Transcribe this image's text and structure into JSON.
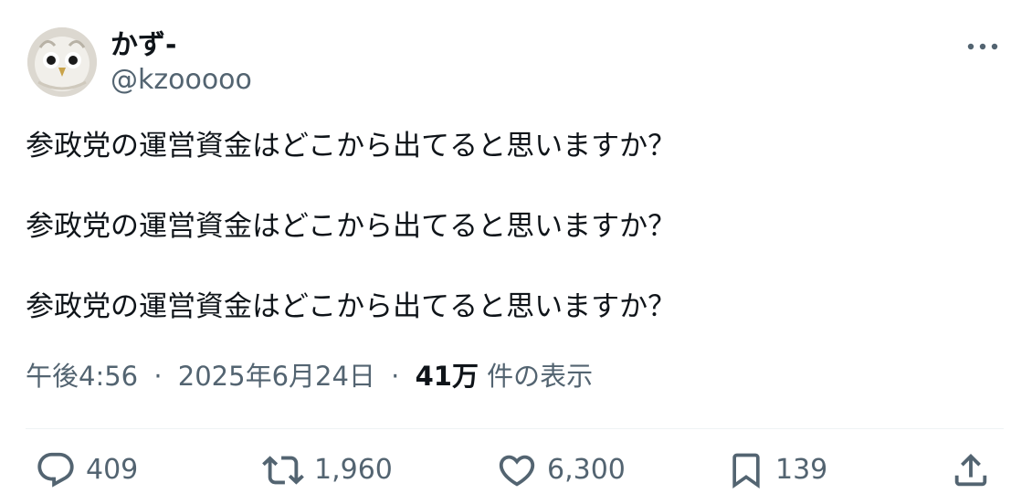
{
  "author": {
    "display_name": "かず-",
    "handle": "@kzooooo",
    "avatar_icon": "owl-avatar-icon"
  },
  "tweet": {
    "lines": [
      "参政党の運営資金はどこから出てると思いますか？",
      "参政党の運営資金はどこから出てると思いますか？",
      "参政党の運営資金はどこから出てると思いますか？"
    ]
  },
  "meta": {
    "time": "午後4:56",
    "separator": "·",
    "date": "2025年6月24日",
    "views_count": "41万",
    "views_label": "件の表示"
  },
  "actions": {
    "reply_count": "409",
    "retweet_count": "1,960",
    "like_count": "6,300",
    "bookmark_count": "139"
  },
  "colors": {
    "text_primary": "#0f1419",
    "text_secondary": "#536471",
    "divider": "#eff3f4"
  }
}
